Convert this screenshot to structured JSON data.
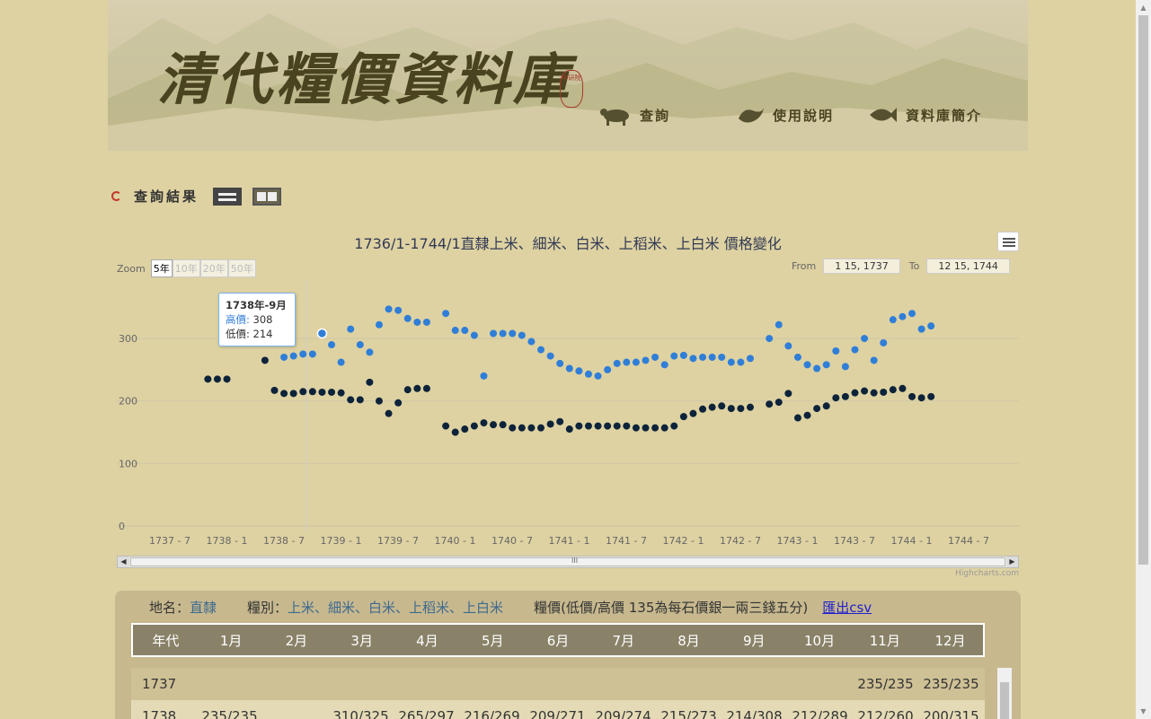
{
  "banner": {
    "title": "清代糧價資料庫",
    "seal": "中研院",
    "nav": [
      {
        "label": "查詢",
        "icon": "ox-icon"
      },
      {
        "label": "使用說明",
        "icon": "bird-icon"
      },
      {
        "label": "資料庫簡介",
        "icon": "fish-icon"
      }
    ]
  },
  "result": {
    "heading": "查詢結果"
  },
  "chart": {
    "title": "1736/1-1744/1直隸上米、細米、白米、上稻米、上白米 價格變化",
    "zoom_label": "Zoom",
    "zoom_buttons": [
      "5年",
      "10年",
      "20年",
      "50年"
    ],
    "from_label": "From",
    "from_value": "1 15, 1737",
    "to_label": "To",
    "to_value": "12 15, 1744",
    "credit": "Highcharts.com",
    "scroll_grip": "III",
    "tooltip": {
      "title": "1738年-9月",
      "hi_label": "高價",
      "hi_value": "308",
      "lo_label": "低價",
      "lo_value": "214"
    },
    "colors": {
      "high": "#2f7ed8",
      "low": "#0d233a"
    }
  },
  "chart_data": {
    "type": "scatter",
    "title": "1736/1-1744/1直隸上米、細米、白米、上稻米、上白米 價格變化",
    "ylim": [
      0,
      350
    ],
    "y_ticks": [
      0,
      100,
      200,
      300
    ],
    "x_tick_labels": [
      "1737 - 7",
      "1738 - 1",
      "1738 - 7",
      "1739 - 1",
      "1739 - 7",
      "1740 - 1",
      "1740 - 7",
      "1741 - 1",
      "1741 - 7",
      "1742 - 1",
      "1742 - 7",
      "1743 - 1",
      "1743 - 7",
      "1744 - 1",
      "1744 - 7"
    ],
    "x_start": "1737-01",
    "series": [
      {
        "name": "高價",
        "color": "#2f7ed8",
        "points": [
          [
            17,
            300
          ],
          [
            18,
            270
          ],
          [
            19,
            272
          ],
          [
            20,
            275
          ],
          [
            21,
            275
          ],
          [
            22,
            308
          ],
          [
            23,
            290
          ],
          [
            24,
            262
          ],
          [
            25,
            315
          ],
          [
            26,
            290
          ],
          [
            27,
            278
          ],
          [
            28,
            322
          ],
          [
            29,
            347
          ],
          [
            30,
            345
          ],
          [
            31,
            332
          ],
          [
            32,
            326
          ],
          [
            33,
            326
          ],
          [
            35,
            340
          ],
          [
            36,
            313
          ],
          [
            37,
            313
          ],
          [
            38,
            305
          ],
          [
            39,
            240
          ],
          [
            40,
            308
          ],
          [
            41,
            308
          ],
          [
            42,
            308
          ],
          [
            43,
            305
          ],
          [
            44,
            295
          ],
          [
            45,
            282
          ],
          [
            46,
            272
          ],
          [
            47,
            260
          ],
          [
            48,
            252
          ],
          [
            49,
            248
          ],
          [
            50,
            243
          ],
          [
            51,
            240
          ],
          [
            52,
            250
          ],
          [
            53,
            260
          ],
          [
            54,
            262
          ],
          [
            55,
            262
          ],
          [
            56,
            265
          ],
          [
            57,
            270
          ],
          [
            58,
            258
          ],
          [
            59,
            272
          ],
          [
            60,
            273
          ],
          [
            61,
            268
          ],
          [
            62,
            270
          ],
          [
            63,
            270
          ],
          [
            64,
            270
          ],
          [
            65,
            262
          ],
          [
            66,
            262
          ],
          [
            67,
            268
          ],
          [
            69,
            300
          ],
          [
            70,
            322
          ],
          [
            71,
            288
          ],
          [
            72,
            270
          ],
          [
            73,
            258
          ],
          [
            74,
            252
          ],
          [
            75,
            258
          ],
          [
            76,
            280
          ],
          [
            77,
            255
          ],
          [
            78,
            282
          ],
          [
            79,
            300
          ],
          [
            80,
            265
          ],
          [
            81,
            293
          ],
          [
            82,
            330
          ],
          [
            83,
            335
          ],
          [
            84,
            340
          ],
          [
            85,
            315
          ],
          [
            86,
            320
          ]
        ]
      },
      {
        "name": "低價",
        "color": "#0d233a",
        "points": [
          [
            10,
            235
          ],
          [
            11,
            235
          ],
          [
            12,
            235
          ],
          [
            16,
            265
          ],
          [
            17,
            217
          ],
          [
            18,
            212
          ],
          [
            19,
            212
          ],
          [
            20,
            215
          ],
          [
            21,
            215
          ],
          [
            22,
            214
          ],
          [
            23,
            214
          ],
          [
            24,
            213
          ],
          [
            25,
            202
          ],
          [
            26,
            202
          ],
          [
            27,
            230
          ],
          [
            28,
            200
          ],
          [
            29,
            180
          ],
          [
            30,
            197
          ],
          [
            31,
            218
          ],
          [
            32,
            220
          ],
          [
            33,
            220
          ],
          [
            35,
            160
          ],
          [
            36,
            150
          ],
          [
            37,
            155
          ],
          [
            38,
            160
          ],
          [
            39,
            165
          ],
          [
            40,
            162
          ],
          [
            41,
            162
          ],
          [
            42,
            157
          ],
          [
            43,
            157
          ],
          [
            44,
            157
          ],
          [
            45,
            157
          ],
          [
            46,
            163
          ],
          [
            47,
            167
          ],
          [
            48,
            155
          ],
          [
            49,
            160
          ],
          [
            50,
            160
          ],
          [
            51,
            160
          ],
          [
            52,
            160
          ],
          [
            53,
            160
          ],
          [
            54,
            160
          ],
          [
            55,
            157
          ],
          [
            56,
            157
          ],
          [
            57,
            157
          ],
          [
            58,
            157
          ],
          [
            59,
            160
          ],
          [
            60,
            175
          ],
          [
            61,
            180
          ],
          [
            62,
            187
          ],
          [
            63,
            190
          ],
          [
            64,
            192
          ],
          [
            65,
            188
          ],
          [
            66,
            188
          ],
          [
            67,
            190
          ],
          [
            69,
            195
          ],
          [
            70,
            198
          ],
          [
            71,
            212
          ],
          [
            72,
            173
          ],
          [
            73,
            177
          ],
          [
            74,
            188
          ],
          [
            75,
            192
          ],
          [
            76,
            205
          ],
          [
            77,
            207
          ],
          [
            78,
            213
          ],
          [
            79,
            216
          ],
          [
            80,
            213
          ],
          [
            81,
            214
          ],
          [
            82,
            218
          ],
          [
            83,
            220
          ],
          [
            84,
            207
          ],
          [
            85,
            205
          ],
          [
            86,
            207
          ]
        ]
      }
    ]
  },
  "table": {
    "place_label": "地名：",
    "place_value": "直隸",
    "grain_label": "糧別：",
    "grain_value": "上米、細米、白米、上稻米、上白米",
    "price_note": "糧價(低價/高價 135為每石價銀一兩三錢五分)",
    "export": "匯出csv",
    "headers": [
      "年代",
      "1月",
      "2月",
      "3月",
      "4月",
      "5月",
      "6月",
      "7月",
      "8月",
      "9月",
      "10月",
      "11月",
      "12月"
    ],
    "rows": [
      [
        "1737",
        "",
        "",
        "",
        "",
        "",
        "",
        "",
        "",
        "",
        "",
        "235/235",
        "235/235"
      ],
      [
        "1738",
        "235/235",
        "",
        "310/325",
        "265/297",
        "216/269",
        "209/271",
        "209/274",
        "215/273",
        "214/308",
        "212/289",
        "212/260",
        "200/315"
      ]
    ]
  }
}
